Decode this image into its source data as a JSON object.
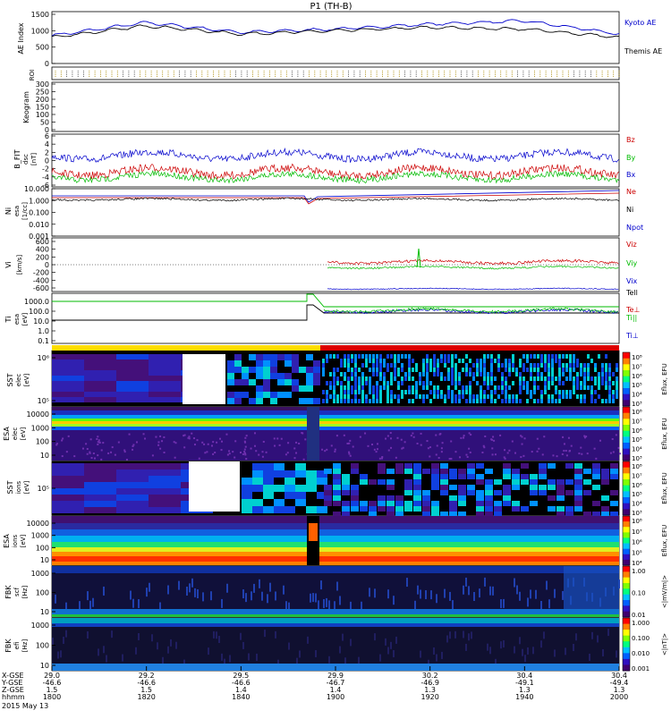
{
  "title": "P1  (TH-B)",
  "panels": {
    "ae": {
      "ylabel": "AE Index",
      "yticks": [
        "1500",
        "1000",
        "500",
        "0"
      ],
      "legend": [
        {
          "text": "Kyoto AE",
          "color": "#0000cc"
        },
        {
          "text": "Themis AE",
          "color": "#000000"
        }
      ]
    },
    "roi": {
      "ylabel": "ROI"
    },
    "keogram": {
      "ylabel": "Keogram",
      "yticks": [
        "300",
        "250",
        "200",
        "150",
        "100",
        "50",
        "0"
      ]
    },
    "bfield": {
      "ylabel": "B_FIT",
      "unit": "[nT]",
      "sub": "dsc",
      "yticks": [
        "6",
        "4",
        "2",
        "0",
        "-2",
        "-4",
        "-6"
      ],
      "legend": [
        {
          "text": "Bz",
          "color": "#cc0000"
        },
        {
          "text": "By",
          "color": "#00bb00"
        },
        {
          "text": "Bx",
          "color": "#0000cc"
        }
      ]
    },
    "density": {
      "ylabel": "Ni",
      "sub": "esa",
      "unit": "[1/cc]",
      "yticks": [
        "10.000",
        "1.000",
        "0.100",
        "0.010",
        "0.001"
      ],
      "legend": [
        {
          "text": "Ne",
          "color": "#cc0000"
        },
        {
          "text": "Ni",
          "color": "#000000"
        },
        {
          "text": "Npot",
          "color": "#0000cc"
        }
      ]
    },
    "velocity": {
      "ylabel": "Vi",
      "unit": "[km/s]",
      "yticks": [
        "600",
        "400",
        "200",
        "0",
        "-200",
        "-400",
        "-600"
      ],
      "legend": [
        {
          "text": "Viz",
          "color": "#cc0000"
        },
        {
          "text": "Viy",
          "color": "#00bb00"
        },
        {
          "text": "Vix",
          "color": "#0000cc"
        }
      ]
    },
    "temp": {
      "ylabel": "Ti",
      "sub": "esa",
      "unit": "[eV]",
      "yticks": [
        "1000.0",
        "100.0",
        "10.0",
        "1.0",
        "0.1"
      ],
      "legend": [
        {
          "text": "Tell",
          "color": "#000000"
        },
        {
          "text": "Te⊥",
          "color": "#cc0000"
        },
        {
          "text": "Ti||",
          "color": "#00bb00"
        },
        {
          "text": "Ti⊥",
          "color": "#0000cc"
        }
      ]
    },
    "sst_e": {
      "ylabel": "SST",
      "sub": "elec",
      "unit": "[eV]",
      "yticks": [
        "10⁶",
        "10⁵"
      ]
    },
    "esa_e": {
      "ylabel": "ESA",
      "sub": "elec",
      "unit": "[eV]",
      "yticks": [
        "10000",
        "1000",
        "100",
        "10"
      ]
    },
    "sst_i": {
      "ylabel": "SST",
      "sub": "ions",
      "unit": "[eV]",
      "yticks": [
        "10⁵"
      ]
    },
    "esa_i": {
      "ylabel": "ESA",
      "sub": "ions",
      "unit": "[eV]",
      "yticks": [
        "10000",
        "1000",
        "100",
        "10"
      ]
    },
    "fbk_scm": {
      "ylabel": "FBK",
      "sub": "scf",
      "unit": "[Hz]",
      "yticks": [
        "1000",
        "100",
        "10"
      ]
    },
    "fbk_efi": {
      "ylabel": "FBK",
      "sub": "efi",
      "unit": "[Hz]",
      "yticks": [
        "1000",
        "100",
        "10"
      ]
    }
  },
  "colorbars": [
    {
      "label": "Eflux, EFU",
      "ticks": [
        "10⁸",
        "10⁷",
        "10⁶",
        "10⁵",
        "10⁴",
        "10³"
      ]
    },
    {
      "label": "Eflux, EFU",
      "ticks": [
        "10⁸",
        "10⁷",
        "10⁶",
        "10⁵",
        "10⁴",
        "10³"
      ]
    },
    {
      "label": "Eflux, EFU",
      "ticks": [
        "10⁸",
        "10⁷",
        "10⁶",
        "10⁵",
        "10⁴",
        "10³"
      ]
    },
    {
      "label": "Eflux, EFU",
      "ticks": [
        "10⁸",
        "10⁷",
        "10⁶",
        "10⁵",
        "10⁴"
      ]
    },
    {
      "label": "<|mV/m|>",
      "ticks": [
        "1.00",
        "0.10",
        "0.01"
      ]
    },
    {
      "label": "<|nT|>",
      "ticks": [
        "1.000",
        "0.100",
        "0.010",
        "0.001"
      ]
    }
  ],
  "xaxis": {
    "row_labels": [
      "X-GSE",
      "Y-GSE",
      "Z-GSE",
      "hhmm",
      "2015 May 13"
    ],
    "columns": [
      {
        "x": "29.0",
        "y": "-46.6",
        "z": "1.5",
        "t": "1800"
      },
      {
        "x": "29.2",
        "y": "-46.6",
        "z": "1.5",
        "t": "1820"
      },
      {
        "x": "29.5",
        "y": "-46.6",
        "z": "1.4",
        "t": "1840"
      },
      {
        "x": "29.9",
        "y": "-46.7",
        "z": "1.4",
        "t": "1900"
      },
      {
        "x": "30.2",
        "y": "-46.9",
        "z": "1.3",
        "t": "1920"
      },
      {
        "x": "30.4",
        "y": "-49.1",
        "z": "1.3",
        "t": "1940"
      },
      {
        "x": "30.4",
        "y": "-49.4",
        "z": "1.3",
        "t": "2000"
      }
    ]
  },
  "colors": {
    "yellow_bar": "#ffdd00",
    "red_bar": "#dd0000"
  },
  "chart_data": {
    "type": "line",
    "title": "P1  (TH-B)",
    "x": [
      "1800",
      "1820",
      "1840",
      "1900",
      "1920",
      "1940",
      "2000"
    ],
    "series": [
      {
        "name": "Kyoto AE",
        "values": [
          850,
          1250,
          950,
          1050,
          1200,
          1300,
          900
        ]
      },
      {
        "name": "Themis AE",
        "values": [
          800,
          1150,
          900,
          1000,
          1100,
          1050,
          800
        ]
      }
    ],
    "ylabel": "AE Index",
    "ylim": [
      0,
      1500
    ]
  }
}
